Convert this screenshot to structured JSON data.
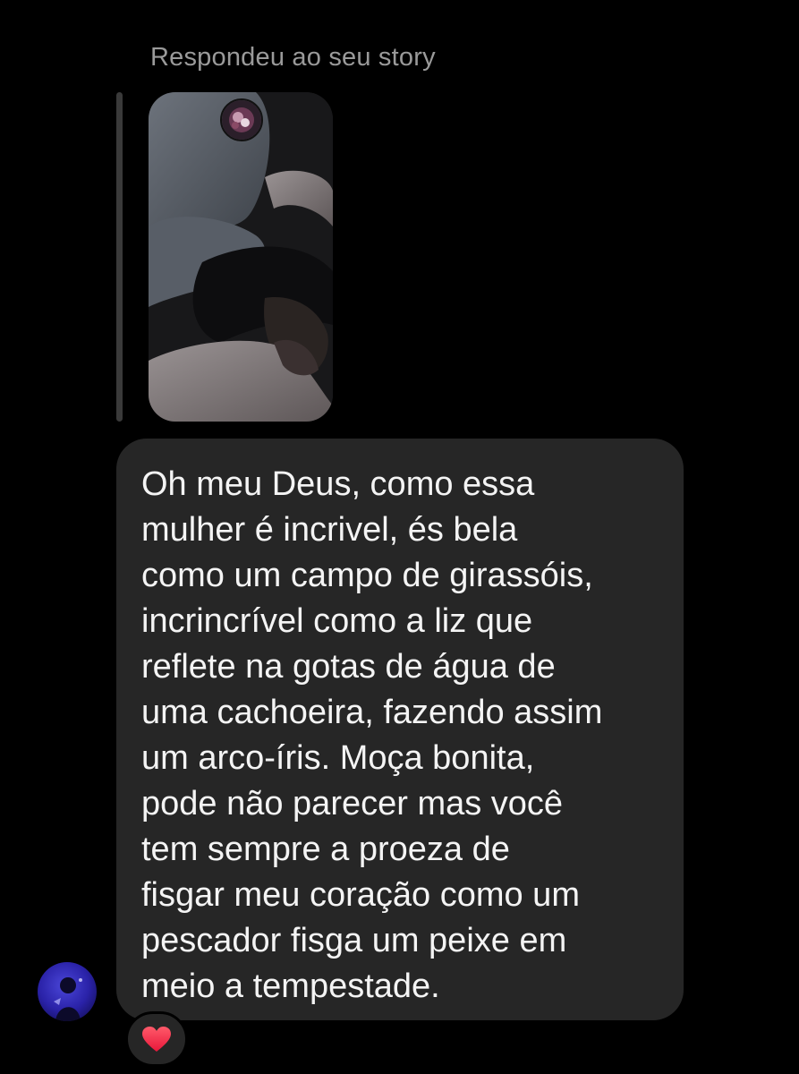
{
  "story_reply": {
    "label": "Respondeu ao seu story"
  },
  "message": {
    "lines": [
      "Oh meu Deus, como essa",
      "mulher é incrivel, és bela",
      "como um campo de girassóis,",
      "incrincrível como a liz que",
      "reflete na gotas de água de",
      "uma cachoeira, fazendo assim",
      "um arco-íris. Moça bonita,",
      "pode não parecer mas você",
      "tem sempre a proeza de",
      "fisgar meu coração como um",
      "pescador fisga um peixe em",
      "meio a tempestade."
    ]
  },
  "reaction": {
    "icon": "heart-icon",
    "color": "#ff3040"
  },
  "colors": {
    "background": "#000000",
    "bubble": "#262626",
    "message_text": "#f4f4f4",
    "reply_label": "#9a9a9a",
    "reply_bar": "#3a3a3a"
  }
}
